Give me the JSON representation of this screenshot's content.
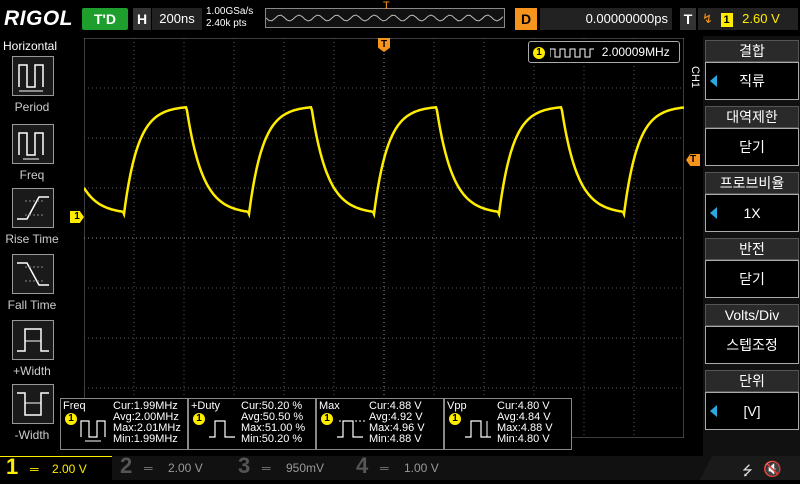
{
  "logo": {
    "text_a": "RIGOL",
    "text_b": ""
  },
  "topbar": {
    "run_status": "T'D",
    "h_label": "H",
    "timebase": "200ns",
    "sample_rate": "1.00GSa/s",
    "mem_depth": "2.40k pts",
    "trig_pos_marker": "T",
    "d_label": "D",
    "delay": "0.00000000ps",
    "t_label": "T",
    "trig_channel": "1",
    "trig_level": "2.60 V"
  },
  "left_menu": {
    "title": "Horizontal",
    "items": [
      {
        "label": "Period"
      },
      {
        "label": "Freq"
      },
      {
        "label": "Rise Time"
      },
      {
        "label": "Fall Time"
      },
      {
        "label": "+Width"
      },
      {
        "label": "-Width"
      }
    ]
  },
  "screen": {
    "freq_readout_channel": "1",
    "freq_readout": "2.00009MHz",
    "ch1_marker": "1",
    "trig_level_marker": "T"
  },
  "right_menu": {
    "channel_label": "CH1",
    "items": [
      {
        "head": "결합",
        "value": "직류"
      },
      {
        "head": "대역제한",
        "value": "닫기"
      },
      {
        "head": "프로브비율",
        "value": "1X"
      },
      {
        "head": "반전",
        "value": "닫기"
      },
      {
        "head": "Volts/Div",
        "value": "스텝조정"
      },
      {
        "head": "단위",
        "value": "[V]"
      }
    ]
  },
  "measurements": [
    {
      "name": "Freq",
      "channel": "1",
      "rows": [
        "Cur:1.99MHz",
        "Avg:2.00MHz",
        "Max:2.01MHz",
        "Min:1.99MHz"
      ]
    },
    {
      "name": "+Duty",
      "channel": "1",
      "rows": [
        "Cur:50.20 %",
        "Avg:50.50 %",
        "Max:51.00 %",
        "Min:50.20 %"
      ]
    },
    {
      "name": "Max",
      "channel": "1",
      "rows": [
        "Cur:4.88 V",
        "Avg:4.92 V",
        "Max:4.96 V",
        "Min:4.88 V"
      ]
    },
    {
      "name": "Vpp",
      "channel": "1",
      "rows": [
        "Cur:4.80 V",
        "Avg:4.84 V",
        "Max:4.88 V",
        "Min:4.80 V"
      ]
    }
  ],
  "bottombar": {
    "channels": [
      {
        "num": "1",
        "scale": "2.00 V",
        "color": "#ffed00"
      },
      {
        "num": "2",
        "scale": "2.00 V",
        "color": "#00c0ff"
      },
      {
        "num": "3",
        "scale": "950mV",
        "color": "#ff2bd6"
      },
      {
        "num": "4",
        "scale": "1.00 V",
        "color": "#1e6bff"
      }
    ]
  },
  "colors": {
    "ch1": "#ffed00",
    "trigger": "#f7941d",
    "menu_accent": "#2aa8e0",
    "run": "#1e9f2d"
  },
  "icons": {
    "usb": "usb-icon",
    "speaker": "speaker-icon"
  }
}
